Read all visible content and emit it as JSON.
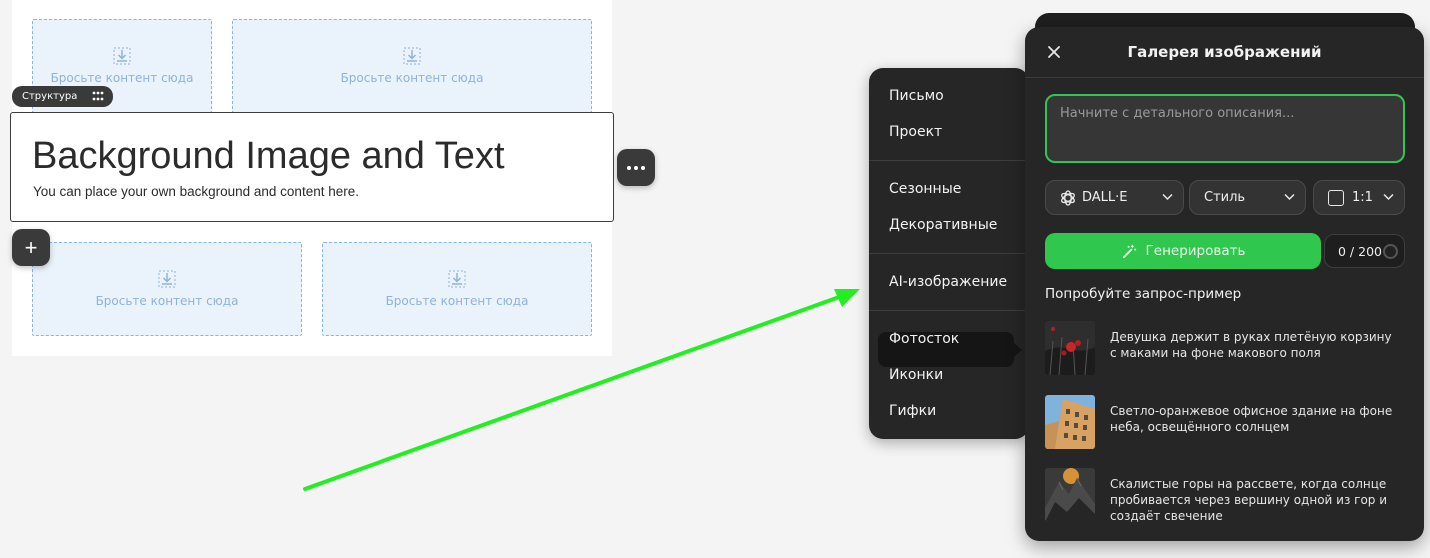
{
  "canvas": {
    "drop_text": "Бросьте контент сюда",
    "structure_badge": "Структура",
    "bg_block": {
      "title": "Background Image and Text",
      "subtitle": "You can place your own background and content here."
    }
  },
  "category_menu": {
    "items": [
      "Письмо",
      "Проект",
      "Сезонные",
      "Декоративные",
      "AI-изображение",
      "Фотосток",
      "Иконки",
      "Гифки"
    ],
    "active": "AI-изображение"
  },
  "gallery": {
    "title": "Галерея изображений",
    "prompt_placeholder": "Начните с детального описания...",
    "model_select": "DALL·E",
    "style_select": "Стиль",
    "ratio_select": "1:1",
    "generate_label": "Генерировать",
    "counter": "0 / 200",
    "examples_label": "Попробуйте запрос-пример",
    "examples": [
      "Девушка держит в руках плетёную корзину с маками на фоне макового поля",
      "Светло-оранжевое офисное здание на фоне неба, освещённого солнцем",
      "Скалистые горы на рассвете, когда солнце пробивается через вершину одной из гор и создаёт свечение"
    ]
  },
  "colors": {
    "accent_green": "#2fc74d",
    "panel_bg": "#262626",
    "arrow": "#22ee22",
    "drop_zone": "#eaf2fc"
  }
}
